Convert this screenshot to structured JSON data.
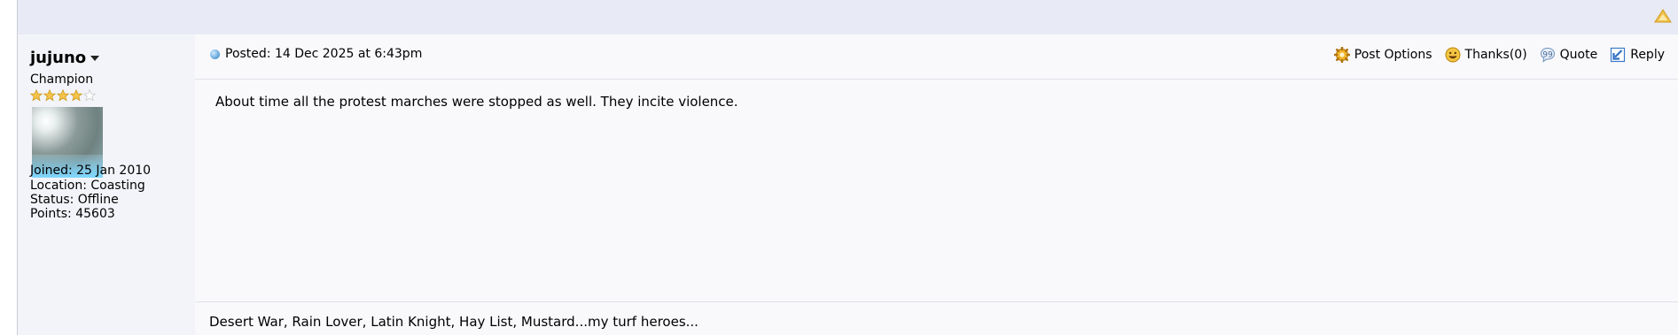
{
  "user": {
    "name": "jujuno",
    "title": "Champion",
    "stars": {
      "filled": 4,
      "total": 5
    },
    "joined": "Joined: 25 Jan 2010",
    "location": "Location: Coasting",
    "status": "Status: Offline",
    "points": "Points: 45603"
  },
  "post": {
    "posted": "Posted: 14 Dec 2025 at 6:43pm",
    "body": "About time all the protest marches were stopped as well. They incite violence.",
    "signature": "Desert War, Rain Lover, Latin Knight, Hay List, Mustard...my turf heroes..."
  },
  "actions": {
    "post_options": "Post Options",
    "thanks": "Thanks(0)",
    "quote": "Quote",
    "reply": "Reply"
  },
  "icons": {
    "top": "go-to-top-icon",
    "post_status": "post-status-dot-icon",
    "post_options": "gear-icon",
    "thanks": "smiley-icon",
    "quote": "quote-bubble-icon",
    "reply": "reply-arrow-icon"
  },
  "colors": {
    "header_bg": "#e8ebf5",
    "user_panel_bg": "#f3f4f9",
    "post_bg": "#f9f9fc",
    "star_gold": "#f6c34a"
  }
}
